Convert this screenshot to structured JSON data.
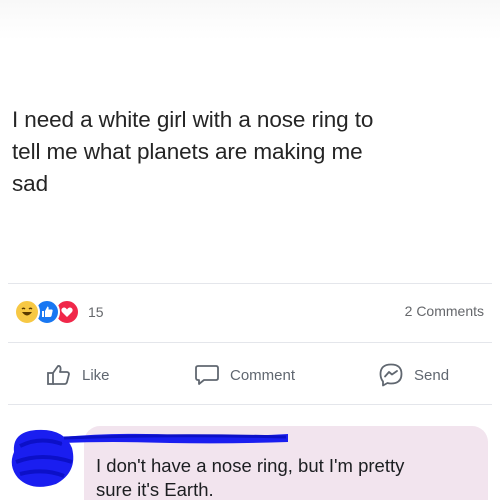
{
  "post": {
    "text": "I need a white girl with a nose ring to\ntell me what planets are making me\nsad"
  },
  "stats": {
    "reaction_count": "15",
    "comments_label": "2 Comments",
    "reactions": [
      "haha-icon",
      "like-icon",
      "love-icon"
    ]
  },
  "actions": {
    "like_label": "Like",
    "comment_label": "Comment",
    "send_label": "Send"
  },
  "comment": {
    "text": "I don't have a nose ring, but I'm pretty\nsure it's Earth."
  },
  "colors": {
    "like_blue": "#1877f2",
    "love_red": "#f0284a",
    "haha_yellow": "#f7c844",
    "scribble_blue": "#1a1ef0",
    "bubble_pink": "#f2e4ee",
    "muted_text": "#65676b"
  }
}
